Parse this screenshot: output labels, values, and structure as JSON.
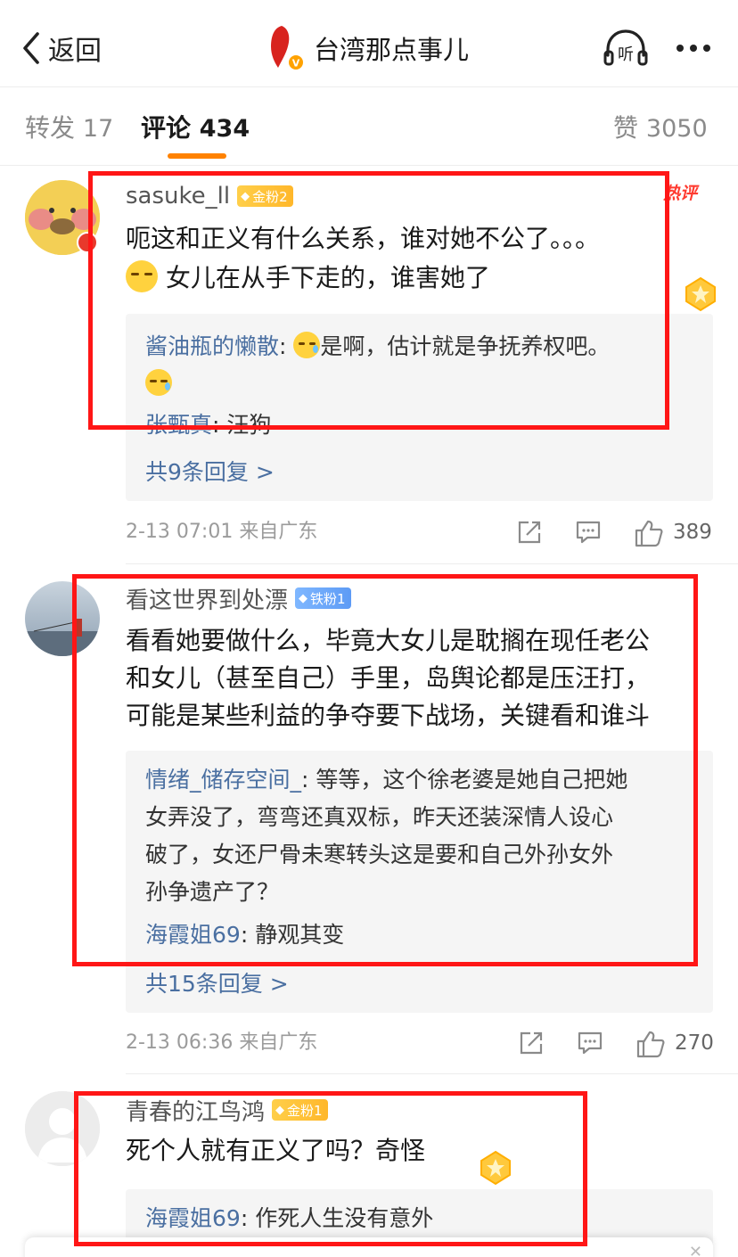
{
  "nav": {
    "back_label": "返回",
    "title": "台湾那点事儿",
    "listen_label": "听"
  },
  "tabs": {
    "repost_label": "转发",
    "repost_count": "17",
    "comment_label": "评论",
    "comment_count": "434",
    "like_label": "赞",
    "like_count": "3050"
  },
  "comments": [
    {
      "username": "sasuke_ll",
      "badge": "金粉2",
      "hot_tag": "热评",
      "text_line1": "呃这和正义有什么关系，谁对她不公了。。。",
      "text_line2": "女儿在从手下走的，谁害她了",
      "replies": [
        {
          "user": "酱油瓶的懒散",
          "text": "是啊，估计就是争抚养权吧。"
        },
        {
          "user": "张甄真",
          "text": "汪狗"
        }
      ],
      "more_replies": "共9条回复 >",
      "meta": "2-13 07:01 来自广东",
      "likes": "389"
    },
    {
      "username": "看这世界到处漂",
      "badge": "铁粉1",
      "text_lines": [
        "看看她要做什么，毕竟大女儿是耽搁在现任老公",
        "和女儿（甚至自己）手里，岛舆论都是压汪打，",
        "可能是某些利益的争夺要下战场，关键看和谁斗"
      ],
      "replies": [
        {
          "user": "情绪_储存空间_",
          "lines": [
            "等等，这个徐老婆是她自己把她",
            "女弄没了，弯弯还真双标，昨天还装深情人设心",
            "破了，女还尸骨未寒转头这是要和自己外孙女外",
            "孙争遗产了？"
          ]
        },
        {
          "user": "海霞姐69",
          "text": "静观其变"
        }
      ],
      "more_replies": "共15条回复 >",
      "meta": "2-13 06:36 来自广东",
      "likes": "270"
    },
    {
      "username": "青春的江鸟鸿",
      "badge": "金粉1",
      "text": "死个人就有正义了吗？奇怪",
      "replies": [
        {
          "user": "海霞姐69",
          "text": "作死人生没有意外"
        }
      ]
    }
  ],
  "colors": {
    "accent": "#ff8200",
    "link": "#4a6fa1",
    "annotation_red": "#ff1616",
    "hot_red": "#ff3b30"
  },
  "icons": [
    "back-chevron-icon",
    "listen-headphones-icon",
    "more-dots-icon",
    "share-icon",
    "comment-icon",
    "like-thumb-icon",
    "medal-icon",
    "emoji-icon"
  ]
}
